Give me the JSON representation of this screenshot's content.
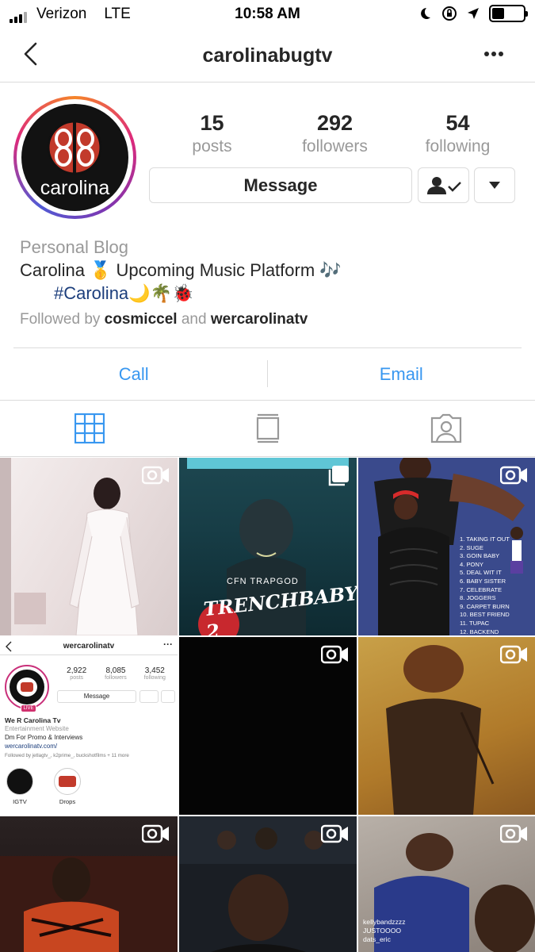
{
  "status_bar": {
    "carrier": "Verizon",
    "network": "LTE",
    "time": "10:58 AM"
  },
  "header": {
    "username": "carolinabugtv"
  },
  "profile": {
    "avatar_text": "carolina",
    "stats": [
      {
        "value": "15",
        "label": "posts"
      },
      {
        "value": "292",
        "label": "followers"
      },
      {
        "value": "54",
        "label": "following"
      }
    ],
    "message_label": "Message",
    "category": "Personal Blog",
    "bio_line1": "Carolina 🥇 Upcoming Music Platform 🎶",
    "bio_line2": "#Carolina🌙🌴🐞",
    "followed_prefix": "Followed by",
    "followed_user1": "cosmiccel",
    "followed_and": "and",
    "followed_user2": "wercarolinatv"
  },
  "actions": {
    "call": "Call",
    "email": "Email"
  },
  "tabs": [
    "grid-icon",
    "feed-icon",
    "tagged-icon"
  ],
  "grid": {
    "post2_title": "TRENCHBABY 2",
    "post2_top": "CFN TRAPGOD",
    "post3_tracks": [
      "1. TAKING IT OUT",
      "2. SUGE",
      "3. GOIN BABY",
      "4. PONY",
      "5. DEAL WIT IT",
      "6. BABY SISTER",
      "7. CELEBRATE",
      "8. JOGGERS",
      "9. CARPET BURN",
      "10. BEST FRIEND",
      "11. TUPAC",
      "12. BACKEND"
    ],
    "post4": {
      "username": "wercarolinatv",
      "stats": [
        {
          "value": "2,922",
          "label": "posts"
        },
        {
          "value": "8,085",
          "label": "followers"
        },
        {
          "value": "3,452",
          "label": "following"
        }
      ],
      "message": "Message",
      "name": "We R Carolina Tv",
      "category": "Entertainment Website",
      "line": "Dm For Promo & Interviews",
      "link": "wercarolinatv.com/",
      "followed": "Followed by jetlagtv_, k2prime_, buckshotfilms + 11 more",
      "highlights": [
        "IGTV",
        "Drops"
      ]
    },
    "post9_comments": [
      {
        "user": "kellybandzzzz",
        "text": "JUSTOOOO"
      },
      {
        "user": "dats_eric",
        "text": ""
      }
    ]
  }
}
